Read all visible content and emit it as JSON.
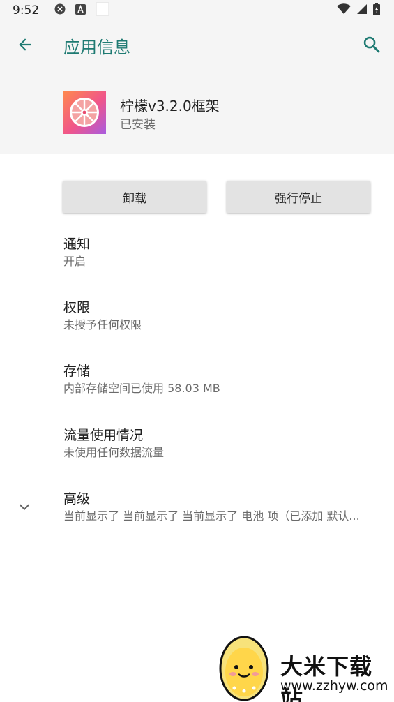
{
  "status_bar": {
    "time": "9:52",
    "icons_left": [
      "close-circle-icon",
      "font-a-icon",
      "blank-notification-icon"
    ],
    "icons_right": [
      "wifi-icon",
      "signal-icon",
      "battery-icon"
    ]
  },
  "app_bar": {
    "title": "应用信息",
    "back_icon": "arrow-left-icon",
    "search_icon": "search-icon",
    "accent_color": "#1e7a72"
  },
  "app": {
    "name": "柠檬v3.2.0框架",
    "status": "已安装",
    "icon": "lemon-slice-app-icon"
  },
  "buttons": {
    "uninstall": "卸载",
    "force_stop": "强行停止"
  },
  "preferences": [
    {
      "title": "通知",
      "summary": "开启"
    },
    {
      "title": "权限",
      "summary": "未授予任何权限"
    },
    {
      "title": "存储",
      "summary": "内部存储空间已使用 58.03 MB"
    },
    {
      "title": "流量使用情况",
      "summary": "未使用任何数据流量"
    },
    {
      "title": "高级",
      "summary": "当前显示了 当前显示了 当前显示了 电池 项（已添加 默认..."
    }
  ],
  "watermark": {
    "text": "大米下载站",
    "url": "www.zzhyw.com"
  }
}
